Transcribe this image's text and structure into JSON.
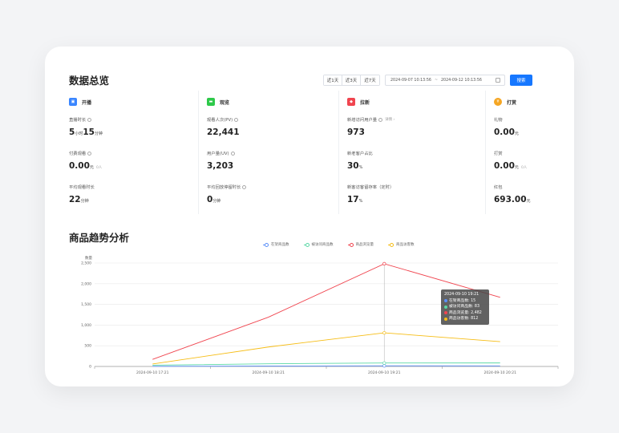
{
  "overview": {
    "title": "数据总览",
    "ranges": [
      "近1天",
      "近3天",
      "近7天"
    ],
    "date_start": "2024-09-07 10:13:56",
    "date_sep": "~",
    "date_end": "2024-09-12 10:13:56",
    "search_label": "搜索"
  },
  "columns": [
    {
      "name": "开播",
      "color": "#3a86ff",
      "stats": [
        {
          "label": "直播时长",
          "value": "5",
          "unit": "小时",
          "value2": "15",
          "unit2": "分钟"
        },
        {
          "label": "付费观看",
          "value": "0.00",
          "unit": "元",
          "sub": "0人"
        },
        {
          "label": "平均观看时长",
          "value": "22",
          "unit": "分钟"
        }
      ]
    },
    {
      "name": "观览",
      "color": "#2ec94a",
      "stats": [
        {
          "label": "观看人次(PV)",
          "value": "22,441"
        },
        {
          "label": "用户量(UV)",
          "value": "3,203"
        },
        {
          "label": "平均回放停留时长",
          "value": "0",
          "unit": "分钟"
        }
      ]
    },
    {
      "name": "拉新",
      "color": "#f0454f",
      "stats": [
        {
          "label": "新增访问用户量",
          "hint": "详情 ›",
          "value": "973"
        },
        {
          "label": "新老客户占比",
          "value": "30",
          "unit": "%"
        },
        {
          "label": "新客访客留存率（定时）",
          "value": "17",
          "unit": "%"
        }
      ]
    },
    {
      "name": "打赏",
      "color": "#f5a623",
      "stats": [
        {
          "label": "礼物",
          "value": "0.00",
          "unit": "元"
        },
        {
          "label": "打赏",
          "value": "0.00",
          "unit": "元",
          "sub": "0人"
        },
        {
          "label": "红包",
          "value": "693.00",
          "unit": "元"
        }
      ]
    }
  ],
  "trend": {
    "title": "商品趋势分析",
    "tooltip": {
      "time": "2024-09-10 19:21",
      "rows": [
        {
          "label": "在架商品数: 15",
          "color": "#5b8ff9"
        },
        {
          "label": "被访问商品数: 83",
          "color": "#5ad8a6"
        },
        {
          "label": "商品浏览量: 2,482",
          "color": "#f0454f"
        },
        {
          "label": "商品访客数: 812",
          "color": "#f6bd16"
        }
      ]
    }
  },
  "chart_data": {
    "type": "line",
    "ylabel": "数量",
    "x": [
      "2024-09-10 17:21",
      "2024-09-10 18:21",
      "2024-09-10 19:21",
      "2024-09-10 20:21"
    ],
    "ylim": [
      0,
      2500
    ],
    "yticks": [
      0,
      500,
      1000,
      1500,
      2000,
      2500
    ],
    "grid": true,
    "legend": "top",
    "series": [
      {
        "name": "在架商品数",
        "color": "#5b8ff9",
        "values": [
          3,
          10,
          15,
          14
        ]
      },
      {
        "name": "被访问商品数",
        "color": "#5ad8a6",
        "values": [
          30,
          65,
          83,
          85
        ]
      },
      {
        "name": "商品浏览量",
        "color": "#f0454f",
        "values": [
          170,
          1190,
          2482,
          1670
        ]
      },
      {
        "name": "商品访客数",
        "color": "#f6bd16",
        "values": [
          60,
          470,
          812,
          600
        ]
      }
    ],
    "highlight_index": 2
  }
}
